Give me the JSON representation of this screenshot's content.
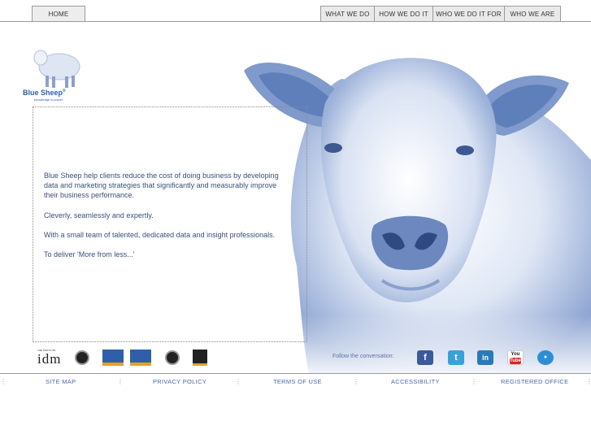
{
  "nav": {
    "home": "HOME",
    "what_we_do": "WHAT WE DO",
    "how_we_do_it": "HOW WE DO IT",
    "who_we_do_it_for": "WHO WE DO IT FOR",
    "who_we_are": "WHO WE ARE"
  },
  "logo": {
    "name": "Blue Sheep",
    "reg": "®",
    "tagline": "knowledge is power"
  },
  "intro": {
    "p1": "Blue Sheep help clients reduce the cost of doing business by developing data and marketing strategies that significantly and measurably improve their business performance.",
    "p2": "Cleverly, seamlessly and expertly.",
    "p3": "With a small team of talented, dedicated data and insight professionals.",
    "p4": "To deliver 'More from less...'"
  },
  "social": {
    "label": "Follow the conversation:",
    "facebook": "f",
    "twitter": "t",
    "linkedin": "in",
    "youtube_top": "You",
    "youtube_bottom": "Tube"
  },
  "certs": {
    "idm_top": "THE INSTITUTE",
    "idm": "idm"
  },
  "footer": {
    "site_map": "SITE MAP",
    "privacy": "PRIVACY POLICY",
    "terms": "TERMS OF USE",
    "accessibility": "ACCESSIBILITY",
    "registered": "REGISTERED OFFICE"
  },
  "colors": {
    "brand": "#2f5fa8",
    "sheep": "#7f9acb",
    "copy": "#3a4f7a",
    "link": "#4a6aa6"
  }
}
